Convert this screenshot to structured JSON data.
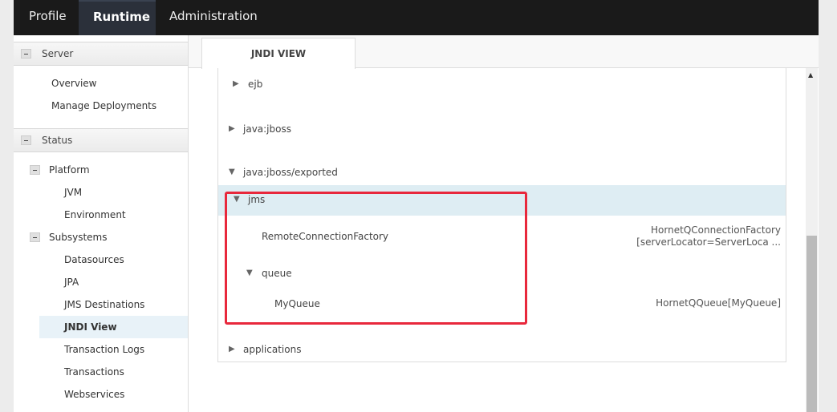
{
  "nav": {
    "tabs": [
      "Profile",
      "Runtime",
      "Administration"
    ],
    "active": "Runtime"
  },
  "sidebar": {
    "server": {
      "label": "Server",
      "items": [
        "Overview",
        "Manage Deployments"
      ]
    },
    "status": {
      "label": "Status",
      "platform": {
        "label": "Platform",
        "items": [
          "JVM",
          "Environment"
        ]
      },
      "subsystems": {
        "label": "Subsystems",
        "items": [
          "Datasources",
          "JPA",
          "JMS Destinations",
          "JNDI View",
          "Transaction Logs",
          "Transactions",
          "Webservices"
        ],
        "selected": "JNDI View"
      }
    }
  },
  "content": {
    "tab": "JNDI VIEW",
    "tree": [
      {
        "label": "ejb",
        "expanded": false
      },
      {
        "label": "java:jboss",
        "expanded": false
      },
      {
        "label": "java:jboss/exported",
        "expanded": true
      },
      {
        "label": "jms",
        "expanded": true,
        "selected": true
      },
      {
        "label": "RemoteConnectionFactory",
        "value1": "HornetQConnectionFactory",
        "value2": "[serverLocator=ServerLoca ..."
      },
      {
        "label": "queue",
        "expanded": true
      },
      {
        "label": "MyQueue",
        "value1": "HornetQQueue[MyQueue]"
      },
      {
        "label": "applications",
        "expanded": false
      }
    ]
  },
  "colors": {
    "highlight": "#e8283c",
    "selected_row": "#deedf3",
    "nav_bg": "#1a1a1a"
  }
}
